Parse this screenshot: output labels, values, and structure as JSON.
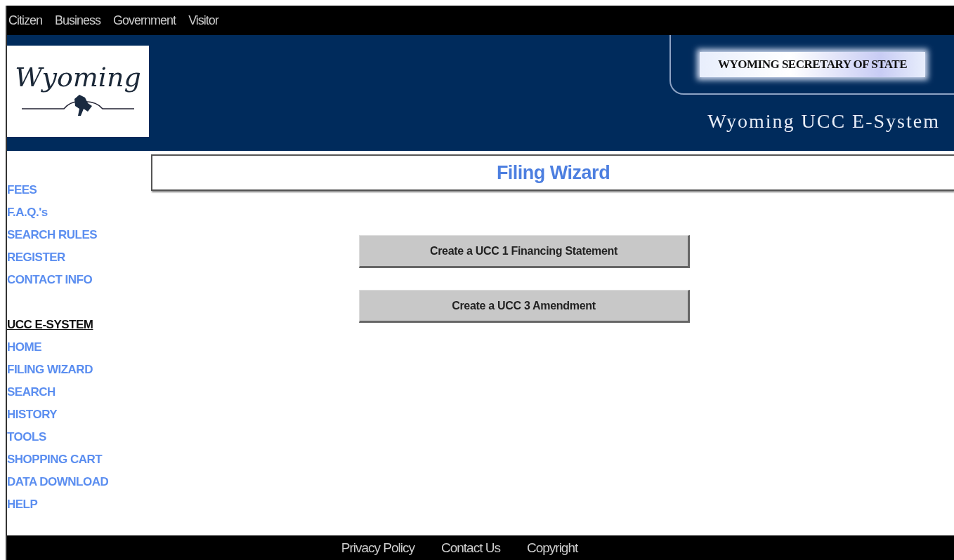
{
  "top_nav": [
    "Citizen",
    "Business",
    "Government",
    "Visitor"
  ],
  "header": {
    "logo_text": "Wyoming",
    "agency_banner": "WYOMING SECRETARY OF STATE",
    "system_title": "Wyoming UCC E-System"
  },
  "page_title": "Filing Wizard",
  "sidebar": [
    {
      "kind": "link",
      "label": "FEES"
    },
    {
      "kind": "link",
      "label": "F.A.Q.'s"
    },
    {
      "kind": "link",
      "label": "SEARCH RULES"
    },
    {
      "kind": "link",
      "label": "REGISTER"
    },
    {
      "kind": "link",
      "label": "CONTACT INFO"
    },
    {
      "kind": "heading",
      "label": "UCC E-SYSTEM"
    },
    {
      "kind": "link",
      "label": "HOME"
    },
    {
      "kind": "link",
      "label": "FILING WIZARD"
    },
    {
      "kind": "link",
      "label": "SEARCH"
    },
    {
      "kind": "link",
      "label": "HISTORY"
    },
    {
      "kind": "link",
      "label": "TOOLS"
    },
    {
      "kind": "link",
      "label": "SHOPPING CART"
    },
    {
      "kind": "link",
      "label": "DATA DOWNLOAD"
    },
    {
      "kind": "link",
      "label": "HELP"
    }
  ],
  "actions": [
    "Create a UCC 1 Financing Statement",
    "Create a UCC 3 Amendment"
  ],
  "footer_links": [
    "Privacy Policy",
    "Contact Us",
    "Copyright"
  ]
}
